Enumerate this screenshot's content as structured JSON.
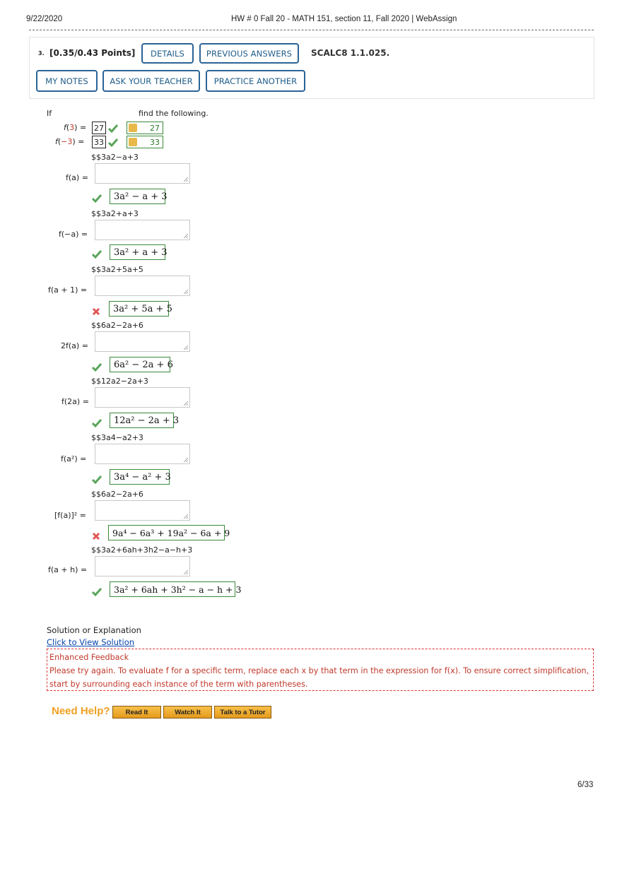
{
  "header": {
    "date": "9/22/2020",
    "title": "HW # 0 Fall 20 - MATH 151, section 11, Fall 2020 | WebAssign",
    "page": "6/33"
  },
  "question": {
    "number": "3.",
    "points": "[0.35/0.43 Points]",
    "details_label": "DETAILS",
    "previous_answers_label": "PREVIOUS ANSWERS",
    "code": "SCALC8 1.1.025.",
    "my_notes_label": "MY NOTES",
    "ask_teacher_label": "ASK YOUR TEACHER",
    "practice_label": "PRACTICE ANOTHER"
  },
  "prompt": {
    "if": "If",
    "find": "find the following."
  },
  "values": [
    {
      "label_fn": "f",
      "arg": "3",
      "eq": ") =",
      "entered": "27",
      "key": "27"
    },
    {
      "label_fn": "f",
      "arg": "−3",
      "eq": ")  =",
      "entered": "33",
      "key": "33"
    }
  ],
  "parts": [
    {
      "raw": "$$3a2−a+3",
      "label": "f(a) =",
      "math": "3a² − a + 3",
      "status": "correct"
    },
    {
      "raw": "$$3a2+a+3",
      "label": "f(−a) =",
      "math": "3a² + a + 3",
      "status": "correct"
    },
    {
      "raw": "$$3a2+5a+5",
      "label": "f(a + 1) =",
      "math": "3a² + 5a + 5",
      "status": "incorrect"
    },
    {
      "raw": "$$6a2−2a+6",
      "label": "2f(a) =",
      "math": "6a² − 2a + 6",
      "status": "correct"
    },
    {
      "raw": "$$12a2−2a+3",
      "label": "f(2a) =",
      "math": "12a² − 2a + 3",
      "status": "correct"
    },
    {
      "raw": "$$3a4−a2+3",
      "label": "f(a²) =",
      "math": "3a⁴ − a² + 3",
      "status": "correct"
    },
    {
      "raw": "$$6a2−2a+6",
      "label": "[f(a)]² =",
      "math": "9a⁴ − 6a³ + 19a² − 6a + 9",
      "status": "incorrect"
    },
    {
      "raw": "$$3a2+6ah+3h2−a−h+3",
      "label": "f(a + h) =",
      "math": "3a² + 6ah + 3h² − a − h + 3",
      "status": "correct"
    }
  ],
  "solution": {
    "heading": "Solution or Explanation",
    "link": "Click to View Solution"
  },
  "feedback": {
    "title": "Enhanced Feedback",
    "text": "Please try again. To evaluate f for a specific term, replace each x by that term in the expression for f(x). To ensure correct simplification, start by surrounding each instance of the term with parentheses."
  },
  "help": {
    "need_help": "Need Help?",
    "read_it": "Read It",
    "watch_it": "Watch It",
    "tutor": "Talk to a Tutor"
  },
  "colors": {
    "button_border": "#2a6496",
    "correct": "#3a8a3a",
    "incorrect": "#d33",
    "link": "#0645ad"
  }
}
